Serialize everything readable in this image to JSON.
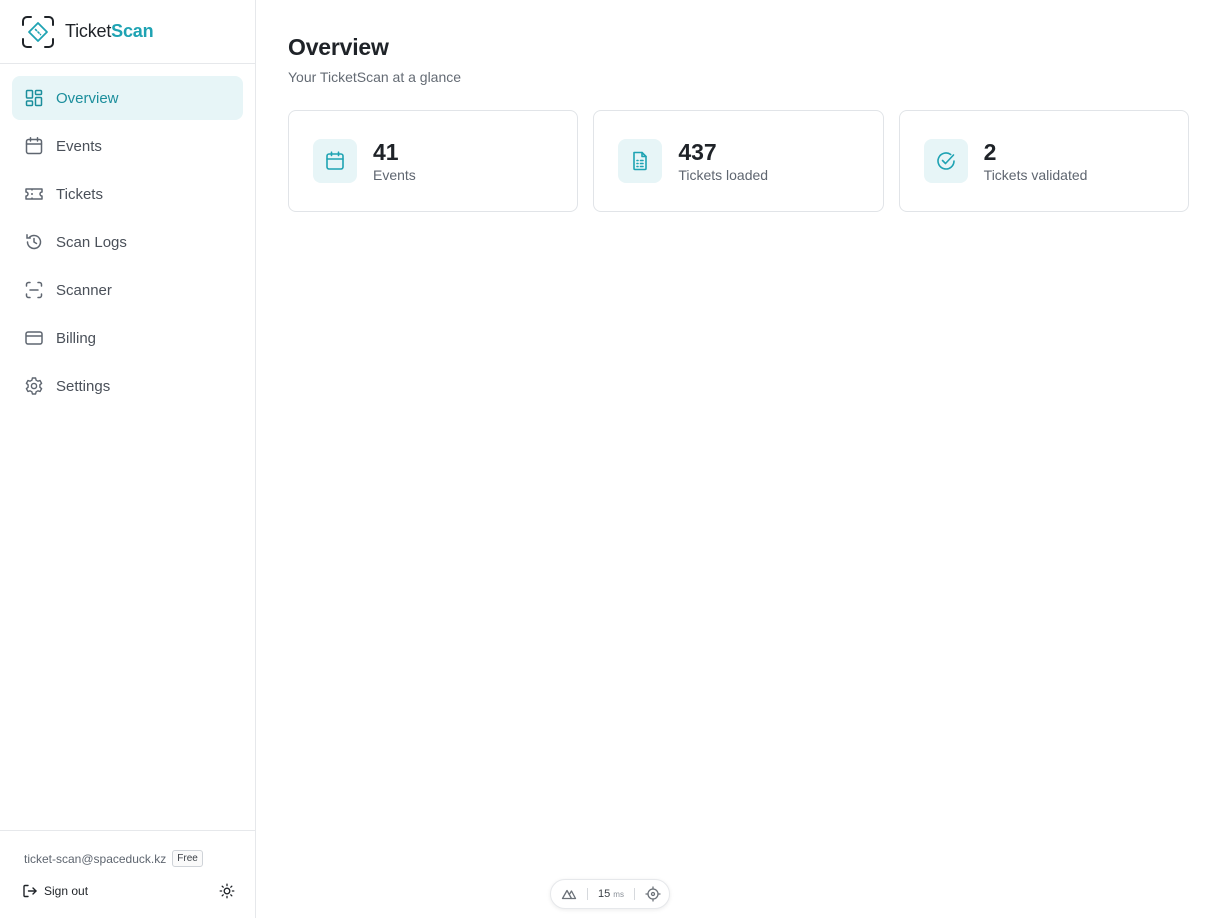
{
  "brand": {
    "name_base": "Ticket",
    "name_accent": "Scan"
  },
  "sidebar": {
    "items": [
      {
        "label": "Overview",
        "icon": "dashboard-icon",
        "active": true
      },
      {
        "label": "Events",
        "icon": "calendar-icon",
        "active": false
      },
      {
        "label": "Tickets",
        "icon": "ticket-icon",
        "active": false
      },
      {
        "label": "Scan Logs",
        "icon": "history-icon",
        "active": false
      },
      {
        "label": "Scanner",
        "icon": "scan-icon",
        "active": false
      },
      {
        "label": "Billing",
        "icon": "credit-card-icon",
        "active": false
      },
      {
        "label": "Settings",
        "icon": "gear-icon",
        "active": false
      }
    ]
  },
  "account": {
    "email": "ticket-scan@spaceduck.kz",
    "plan": "Free",
    "signout_label": "Sign out"
  },
  "main": {
    "title": "Overview",
    "subtitle": "Your TicketScan at a glance",
    "stats": [
      {
        "value": "41",
        "label": "Events",
        "icon": "calendar-icon"
      },
      {
        "value": "437",
        "label": "Tickets loaded",
        "icon": "document-icon"
      },
      {
        "value": "2",
        "label": "Tickets validated",
        "icon": "check-circle-icon"
      }
    ]
  },
  "devbar": {
    "ms_value": "15",
    "ms_unit": "ms"
  },
  "colors": {
    "accent": "#1fa3b3",
    "accent_bg": "#e7f5f7",
    "border": "#e1e4e8"
  }
}
